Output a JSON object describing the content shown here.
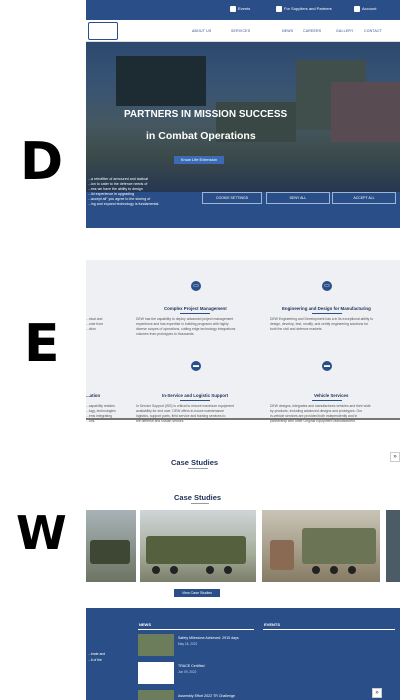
{
  "brand": {
    "letter_1": "D",
    "letter_2": "E",
    "letter_3": "W"
  },
  "topbar": {
    "item_1": "Events",
    "item_2": "For Suppliers and Partners",
    "item_3": "Account"
  },
  "nav": {
    "items": [
      "ABOUT US",
      "SERVICES",
      "NEWS",
      "CAREERS",
      "GALLERY",
      "CONTACT"
    ]
  },
  "hero": {
    "tagline_1": "PARTNERS IN MISSION SUCCESS",
    "tagline_2": "in Combat Operations",
    "cta_label": "Know Life Extension",
    "paragraph": [
      "...a retrofitter of armoured and tactical",
      "...ion to cater to the defence needs of",
      "...ess we have the ability to design",
      "...lid experience in upgrading",
      "...accept all\" you agree to the storing of",
      "...ing and expand technology is fundamental."
    ],
    "cookie_settings": "COOKIE SETTINGS",
    "deny_all": "DENY ALL",
    "accept_all": "ACCEPT ALL"
  },
  "services": [
    {
      "icon": "monitor-icon",
      "title": "Complex Project Management",
      "desc": [
        "DEW has the capability to deploy advanced project management",
        "experience and has expertise in building programs with highly",
        "diverse scopes of operations, cutting edge technology integrations",
        "volumes from prototypes to thousands."
      ]
    },
    {
      "icon": "monitor-icon",
      "title": "Engineering and Design for Manufacturing",
      "desc": [
        "DEW Engineering and Development has a in its exceptional ability to",
        "design, develop, test, modify, and certify engineering solutions for",
        "both the civil and defence markets."
      ]
    },
    {
      "icon": "truck-icon",
      "title": "In-Service and Logistic Support",
      "desc": [
        "In Service Support (ISS) is critical to ensure maximum equipment",
        "availability for end user. DEW offers in-house maintenance",
        "logistics, support parts, field service and training services to",
        "the defense and civilian sectors."
      ]
    },
    {
      "icon": "truck-icon",
      "title": "Vehicle Services",
      "desc": [
        "DEW designs, integrates and manufactures vehicles and their wide",
        "by-products, including advanced designs and prototypes. Our",
        "in-vehicle services are provided both independently and in",
        "partnership with other Original Equipment Manufacturers."
      ]
    }
  ],
  "left_fragments": {
    "svc_1": [
      "...nical and",
      "...ome from",
      "...ction"
    ],
    "svc_3_title": "...ation",
    "svc_3": [
      "...capability resides",
      "...logy, technologies",
      "...ems integrating",
      "...ons."
    ]
  },
  "case_studies": {
    "title_faded": "Case Studies",
    "title": "Case Studies",
    "button": "View Case Studies"
  },
  "footer": {
    "news_header": "NEWS",
    "events_header": "EVENTS",
    "news": [
      {
        "title": "Safety Milestone Achieved: 2915 days",
        "date": "May 18, 2022"
      },
      {
        "title": "TRACE Certified",
        "date": "Jun 09, 2022"
      },
      {
        "title": "Assembly Effort 2022 TR Challenge",
        "date": ""
      }
    ],
    "left_fragment": [
      "...brate and",
      "...it of the"
    ]
  },
  "scroll_top_label": "»",
  "colors": {
    "primary": "#2a4f88",
    "accent": "#3c6bb5",
    "grey_bg": "#eef0f3"
  }
}
